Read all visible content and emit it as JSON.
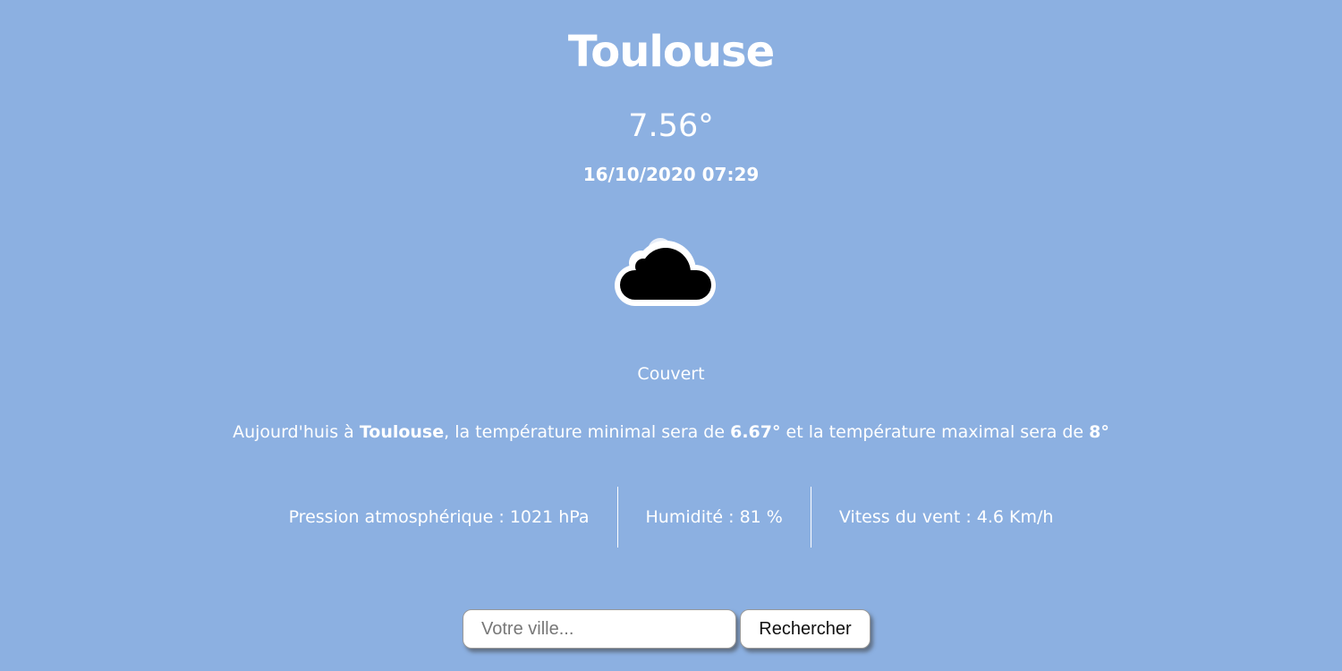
{
  "weather": {
    "city": "Toulouse",
    "temperature": "7.56°",
    "datetime": "16/10/2020 07:29",
    "icon": "cloud-icon",
    "description": "Couvert"
  },
  "summary": {
    "prefix": "Aujourd'huis à ",
    "city": "Toulouse",
    "mid1": ", la température minimal sera de ",
    "min": "6.67°",
    "mid2": " et la température maximal sera de ",
    "max": "8°"
  },
  "stats": {
    "pressure": "Pression atmosphérique : 1021 hPa",
    "humidity": "Humidité : 81 %",
    "wind": "Vitess du vent : 4.6 Km/h"
  },
  "search": {
    "placeholder": "Votre ville...",
    "value": "",
    "button_label": "Rechercher"
  },
  "colors": {
    "background": "#8cb0e1",
    "text": "#ffffff"
  }
}
